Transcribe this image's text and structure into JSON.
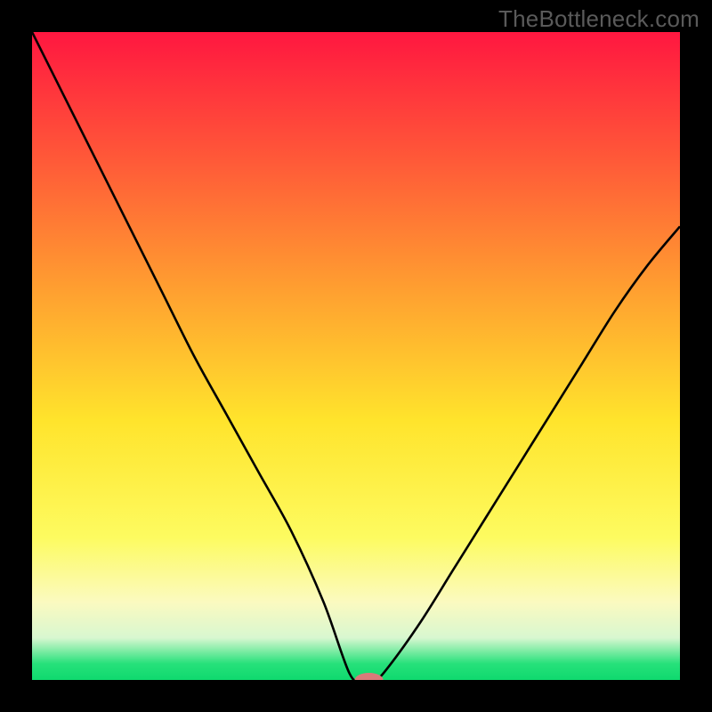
{
  "watermark": "TheBottleneck.com",
  "chart_data": {
    "type": "line",
    "title": "",
    "xlabel": "",
    "ylabel": "",
    "xlim": [
      0,
      100
    ],
    "ylim": [
      0,
      100
    ],
    "grid": false,
    "legend": false,
    "background_gradient": {
      "stops": [
        {
          "offset": 0.0,
          "color": "#ff1740"
        },
        {
          "offset": 0.2,
          "color": "#ff5a38"
        },
        {
          "offset": 0.4,
          "color": "#ffa030"
        },
        {
          "offset": 0.6,
          "color": "#ffe42c"
        },
        {
          "offset": 0.78,
          "color": "#fdfb60"
        },
        {
          "offset": 0.88,
          "color": "#fbfac0"
        },
        {
          "offset": 0.935,
          "color": "#d8f7d0"
        },
        {
          "offset": 0.975,
          "color": "#26e17a"
        },
        {
          "offset": 1.0,
          "color": "#0fd96e"
        }
      ]
    },
    "series": [
      {
        "name": "bottleneck-curve",
        "x": [
          0,
          5,
          10,
          15,
          20,
          25,
          30,
          35,
          40,
          45,
          49,
          51,
          53,
          55,
          60,
          65,
          70,
          75,
          80,
          85,
          90,
          95,
          100
        ],
        "y": [
          100,
          90,
          80,
          70,
          60,
          50,
          41,
          32,
          23,
          12,
          1,
          0,
          0,
          2,
          9,
          17,
          25,
          33,
          41,
          49,
          57,
          64,
          70
        ],
        "stroke": "#000000",
        "stroke_width": 2.6
      }
    ],
    "marker": {
      "cx": 52,
      "cy": 0,
      "rx": 2.2,
      "ry": 1.1,
      "fill": "#d97a7a"
    }
  }
}
